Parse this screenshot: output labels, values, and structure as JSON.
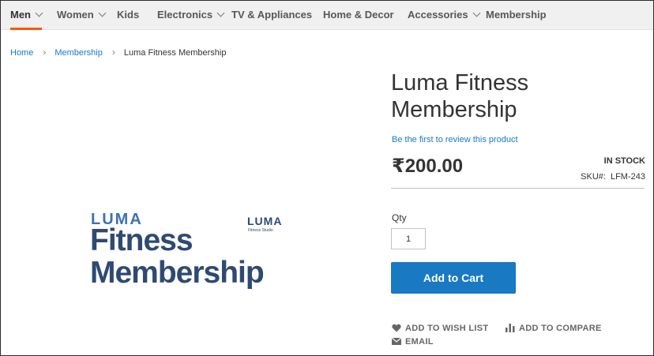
{
  "nav": {
    "items": [
      {
        "label": "Men",
        "has_menu": true,
        "active": true
      },
      {
        "label": "Women",
        "has_menu": true,
        "active": false
      },
      {
        "label": "Kids",
        "has_menu": false,
        "active": false
      },
      {
        "label": "Electronics",
        "has_menu": true,
        "active": false
      },
      {
        "label": "TV & Appliances",
        "has_menu": false,
        "active": false
      },
      {
        "label": "Home & Decor",
        "has_menu": false,
        "active": false
      },
      {
        "label": "Accessories",
        "has_menu": true,
        "active": false
      },
      {
        "label": "Membership",
        "has_menu": false,
        "active": false
      }
    ]
  },
  "breadcrumb": {
    "items": [
      "Home",
      "Membership",
      "Luma Fitness Membership"
    ]
  },
  "product_image": {
    "brand": "LUMA",
    "title_line1": "Fitness",
    "title_line2": "Membership",
    "small_brand": "LUMA",
    "small_sub": "Fitness Studio"
  },
  "product": {
    "title": "Luma Fitness Membership",
    "review_link": "Be the first to review this product",
    "price": "₹200.00",
    "stock": "IN STOCK",
    "sku_label": "SKU#:",
    "sku_value": "LFM-243",
    "qty_label": "Qty",
    "qty_value": "1",
    "add_to_cart": "Add to Cart",
    "wishlist": "ADD TO WISH LIST",
    "compare": "ADD TO COMPARE",
    "email": "EMAIL"
  },
  "colors": {
    "accent": "#1979c3",
    "nav_active": "#ff5501",
    "image_navy": "#2e4a73",
    "image_blue": "#3d72b2"
  }
}
